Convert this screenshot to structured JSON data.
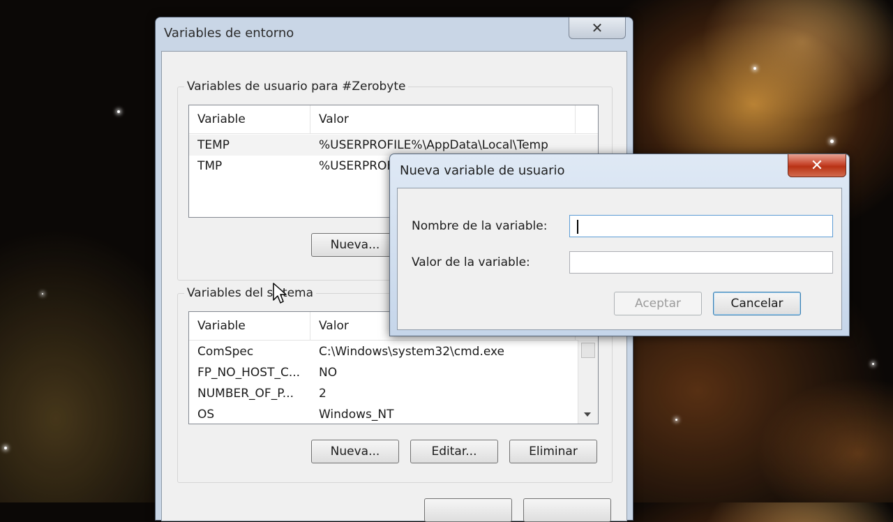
{
  "main_window": {
    "title": "Variables de entorno",
    "close_glyph": "✕",
    "user_vars": {
      "group_label": "Variables de usuario para #Zerobyte",
      "columns": [
        "Variable",
        "Valor"
      ],
      "rows": [
        {
          "variable": "TEMP",
          "value": "%USERPROFILE%\\AppData\\Local\\Temp"
        },
        {
          "variable": "TMP",
          "value": "%USERPROFILE%\\AppData\\Local\\Temp"
        }
      ],
      "new_button": "Nueva..."
    },
    "system_vars": {
      "group_label": "Variables del sistema",
      "columns": [
        "Variable",
        "Valor"
      ],
      "rows": [
        {
          "variable": "ComSpec",
          "value": "C:\\Windows\\system32\\cmd.exe"
        },
        {
          "variable": "FP_NO_HOST_C...",
          "value": "NO"
        },
        {
          "variable": "NUMBER_OF_P...",
          "value": "2"
        },
        {
          "variable": "OS",
          "value": "Windows_NT"
        }
      ],
      "new_button": "Nueva...",
      "edit_button": "Editar...",
      "delete_button": "Eliminar"
    }
  },
  "new_var_dialog": {
    "title": "Nueva variable de usuario",
    "close_glyph": "✕",
    "name_label": "Nombre de la variable:",
    "name_value": "",
    "value_label": "Valor de la variable:",
    "value_value": "",
    "accept_button": "Aceptar",
    "cancel_button": "Cancelar"
  }
}
